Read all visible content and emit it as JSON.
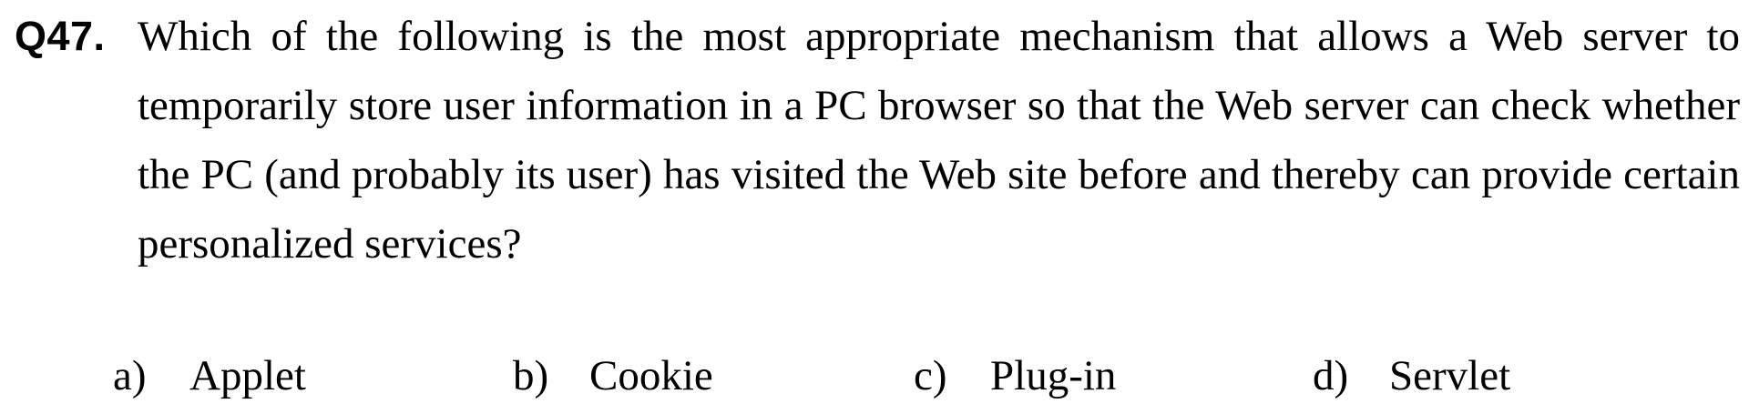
{
  "question": {
    "number": "Q47.",
    "text": "Which of the following is the most appropriate mechanism that allows a Web server to temporarily store user information in a PC browser so that the Web server can check whether the PC (and probably its user) has visited the Web site before and thereby can provide certain personalized services?"
  },
  "options": [
    {
      "letter": "a)",
      "text": "Applet"
    },
    {
      "letter": "b)",
      "text": "Cookie"
    },
    {
      "letter": "c)",
      "text": "Plug-in"
    },
    {
      "letter": "d)",
      "text": "Servlet"
    }
  ]
}
